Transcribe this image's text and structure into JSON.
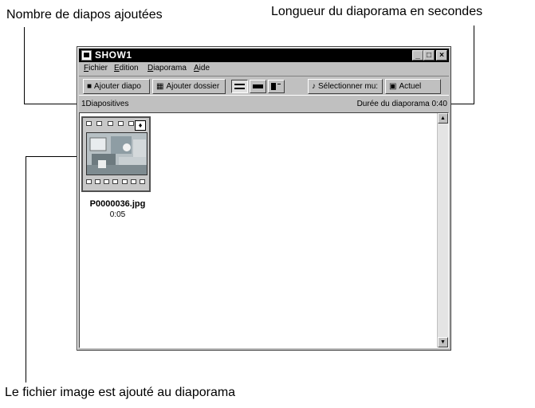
{
  "annotations": {
    "slides_added": "Nombre de diapos ajoutées",
    "slideshow_length": "Longueur du diaporama en secondes",
    "file_added": "Le fichier image est ajouté au diaporama"
  },
  "window": {
    "title": "SHOW1",
    "minimize": "_",
    "maximize": "□",
    "close": "×"
  },
  "menu": {
    "fichier_key": "F",
    "fichier_rest": "ichier",
    "edition_key": "E",
    "edition_rest": "dition",
    "diaporama_key": "D",
    "diaporama_rest": "iaporama",
    "aide_key": "A",
    "aide_rest": "ide"
  },
  "toolbar": {
    "add_slide": "Ajouter diapo",
    "add_folder": "Ajouter dossier",
    "select_music": "Sélectionner mu:",
    "current": "Actuel"
  },
  "status": {
    "slides_count": "1Diapositives",
    "duration": "Durée du diaporama 0:40"
  },
  "slides": [
    {
      "file_name": "P0000036.jpg",
      "duration": "0:05"
    }
  ]
}
